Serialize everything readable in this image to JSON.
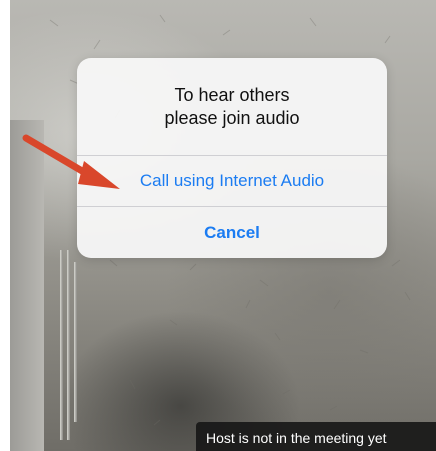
{
  "dialog": {
    "title_line1": "To hear others",
    "title_line2": "please join audio",
    "call_label": "Call using Internet Audio",
    "cancel_label": "Cancel"
  },
  "banner": {
    "text": "Host is not in the meeting yet"
  },
  "colors": {
    "accent": "#1b7cf2",
    "annotation_arrow": "#d9472b",
    "banner_bg": "#161616"
  },
  "icons": {
    "annotation": "arrow-icon"
  }
}
